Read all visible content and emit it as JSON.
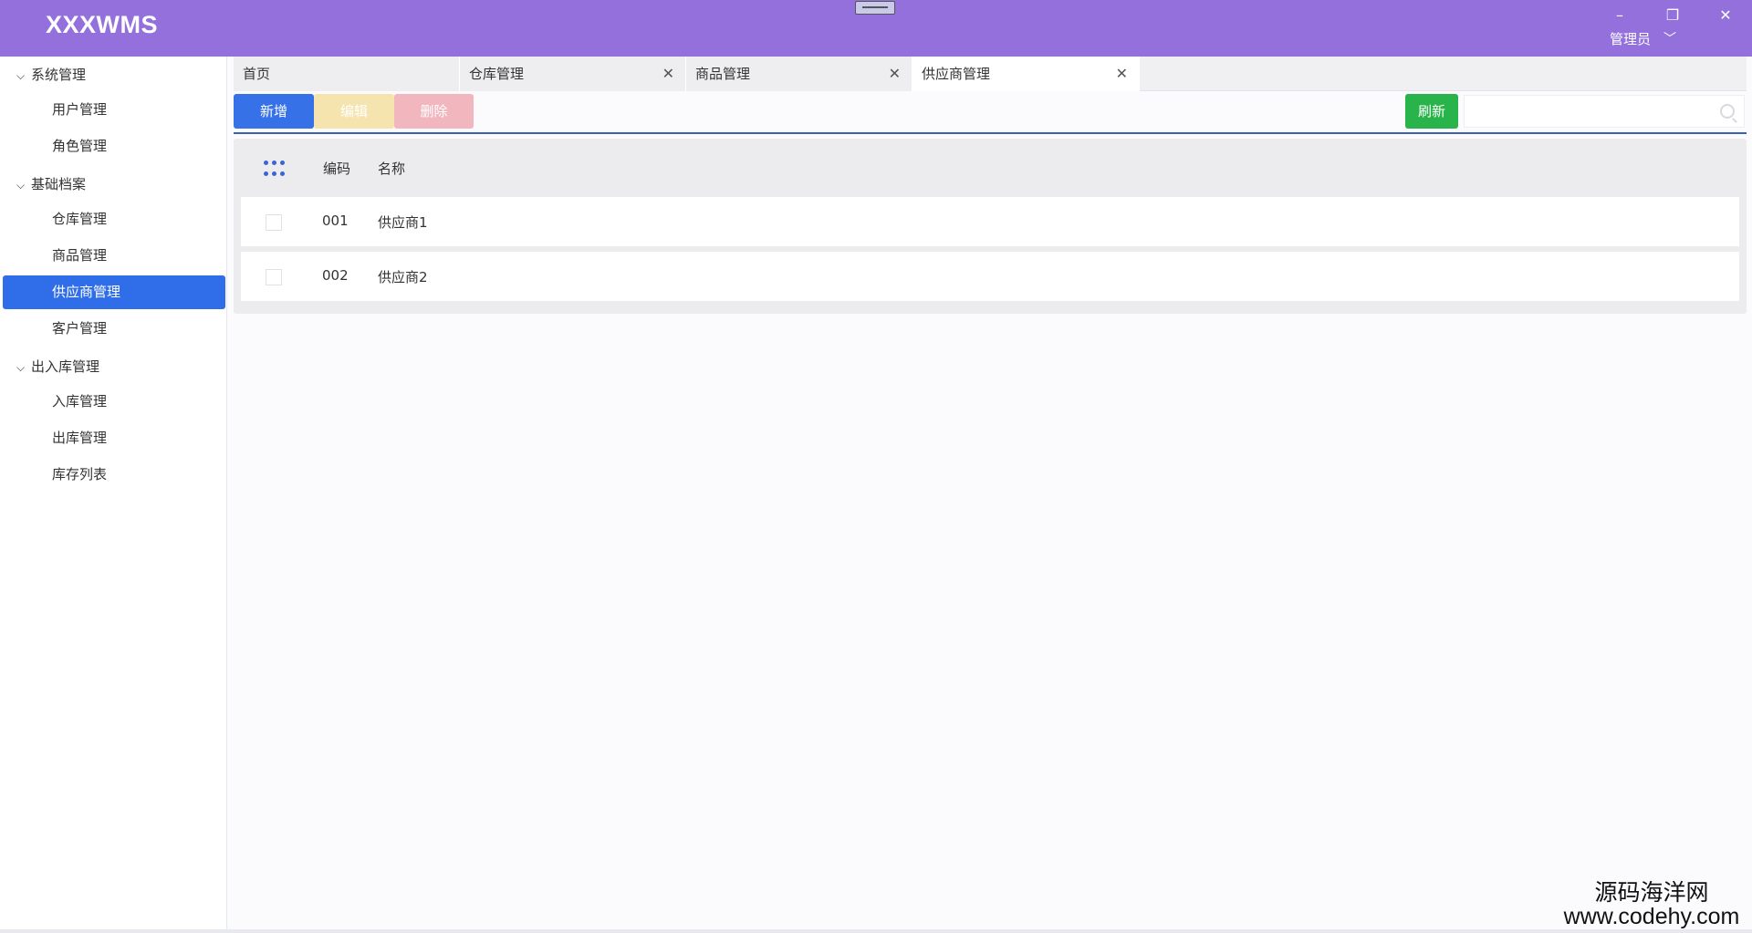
{
  "app": {
    "title": "XXXWMS",
    "user": "管理员"
  },
  "window_controls": {
    "minimize": "–",
    "restore": "❐",
    "close": "✕"
  },
  "sidebar": {
    "groups": [
      {
        "label": "系统管理",
        "items": [
          {
            "label": "用户管理"
          },
          {
            "label": "角色管理"
          }
        ]
      },
      {
        "label": "基础档案",
        "items": [
          {
            "label": "仓库管理"
          },
          {
            "label": "商品管理"
          },
          {
            "label": "供应商管理",
            "active": true
          },
          {
            "label": "客户管理"
          }
        ]
      },
      {
        "label": "出入库管理",
        "items": [
          {
            "label": "入库管理"
          },
          {
            "label": "出库管理"
          },
          {
            "label": "库存列表"
          }
        ]
      }
    ]
  },
  "tabs": [
    {
      "label": "首页",
      "closable": false
    },
    {
      "label": "仓库管理",
      "closable": true
    },
    {
      "label": "商品管理",
      "closable": true
    },
    {
      "label": "供应商管理",
      "closable": true,
      "active": true
    }
  ],
  "toolbar": {
    "add_label": "新增",
    "edit_label": "编辑",
    "delete_label": "删除",
    "refresh_label": "刷新",
    "search_placeholder": "",
    "colors": {
      "add": "#3671e8",
      "edit": "#f5e4ad",
      "delete": "#f2b7be",
      "refresh": "#29b34b"
    }
  },
  "table": {
    "columns": [
      "编码",
      "名称"
    ],
    "rows": [
      {
        "code": "001",
        "name": "供应商1"
      },
      {
        "code": "002",
        "name": "供应商2"
      }
    ]
  },
  "watermark": {
    "line1": "源码海洋网",
    "line2": "www.codehy.com"
  },
  "colors": {
    "titlebar": "#9370db",
    "active_nav": "#2f6ee8"
  }
}
